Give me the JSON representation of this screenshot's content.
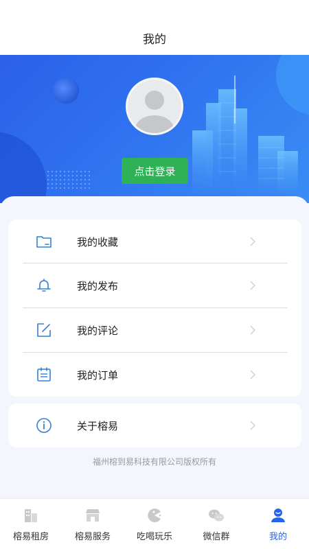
{
  "header": {
    "title": "我的"
  },
  "profile": {
    "login_label": "点击登录"
  },
  "menu": {
    "items": [
      {
        "label": "我的收藏",
        "icon": "folder-icon"
      },
      {
        "label": "我的发布",
        "icon": "bell-icon"
      },
      {
        "label": "我的评论",
        "icon": "edit-icon"
      },
      {
        "label": "我的订单",
        "icon": "calendar-icon"
      }
    ],
    "about": {
      "label": "关于榕易",
      "icon": "info-icon"
    }
  },
  "footer": {
    "copyright": "福州榕到易科技有限公司版权所有"
  },
  "tabbar": {
    "items": [
      {
        "label": "榕易租房",
        "icon": "building-icon",
        "active": false
      },
      {
        "label": "榕易服务",
        "icon": "shop-icon",
        "active": false
      },
      {
        "label": "吃喝玩乐",
        "icon": "pacman-icon",
        "active": false
      },
      {
        "label": "微信群",
        "icon": "wechat-icon",
        "active": false
      },
      {
        "label": "我的",
        "icon": "user-icon",
        "active": true
      }
    ]
  },
  "colors": {
    "accent": "#2563e8",
    "login": "#2fb155",
    "hero": "#2f72f0"
  }
}
